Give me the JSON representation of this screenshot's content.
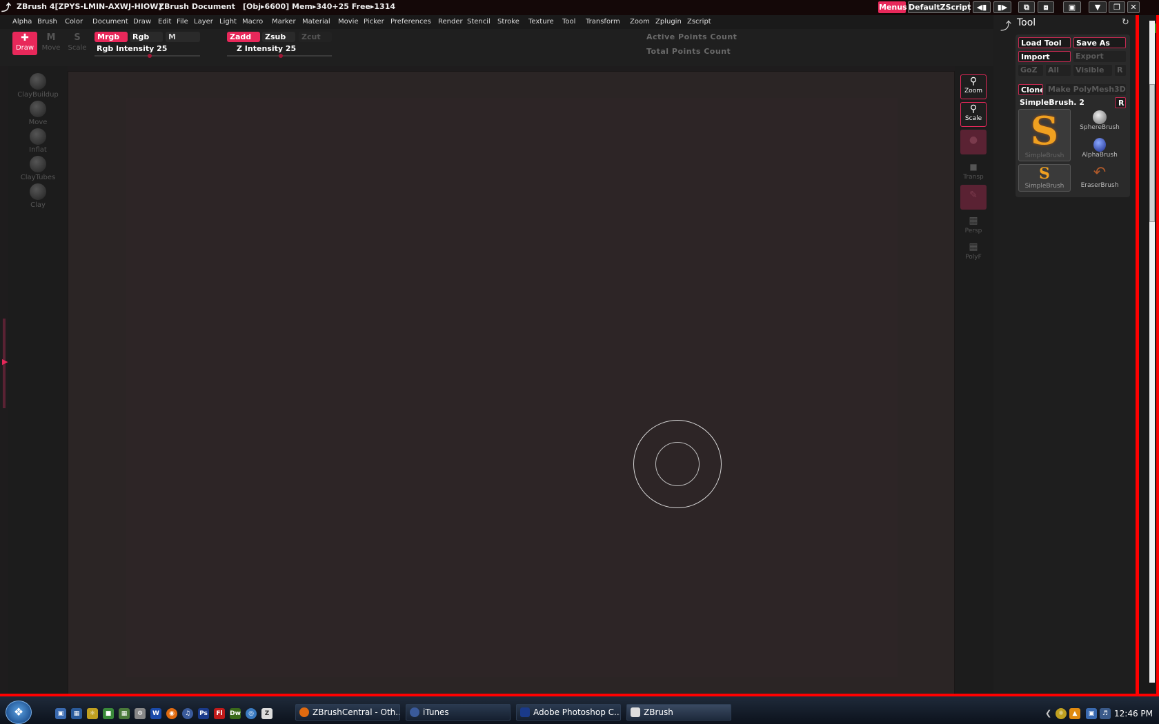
{
  "title_bar": {
    "app_title": "ZBrush 4[ZPYS-LMIN-AXWJ-HIOW]",
    "document": "ZBrush Document",
    "stats": "[Obj▸6600] Mem▸340+25 Free▸1314",
    "menus_button": "Menus",
    "zscript_button": "DefaultZScript"
  },
  "menu_bar": [
    "Alpha",
    "Brush",
    "Color",
    "Document",
    "Draw",
    "Edit",
    "File",
    "Layer",
    "Light",
    "Macro",
    "Marker",
    "Material",
    "Movie",
    "Picker",
    "Preferences",
    "Render",
    "Stencil",
    "Stroke",
    "Texture",
    "Tool",
    "Transform",
    "Zoom",
    "Zplugin",
    "Zscript"
  ],
  "shelf": {
    "draw_label": "Draw",
    "move_label": "Move",
    "scale_label": "Scale",
    "mrgb": "Mrgb",
    "rgb": "Rgb",
    "m": "M",
    "rgb_intensity_label": "Rgb Intensity",
    "rgb_intensity_value": "25",
    "zadd": "Zadd",
    "zsub": "Zsub",
    "zcut": "Zcut",
    "z_intensity_label": "Z Intensity",
    "z_intensity_value": "25",
    "active_points": "Active Points Count",
    "total_points": "Total Points Count"
  },
  "left_shelf": [
    "ClayBuildup",
    "Move",
    "Inflat",
    "ClayTubes",
    "Clay"
  ],
  "right_shelf": {
    "zoom": "Zoom",
    "scale": "Scale",
    "transp": "Transp",
    "persp": "Persp",
    "polyf": "PolyF"
  },
  "tool_panel": {
    "title": "Tool",
    "load_tool": "Load Tool",
    "save_as": "Save As",
    "import": "Import",
    "export": "Export",
    "goz": "GoZ",
    "all": "All",
    "visible": "Visible",
    "r": "R",
    "clone": "Clone",
    "make_polymesh": "Make PolyMesh3D",
    "current_tool": "SimpleBrush. 2",
    "r2": "R",
    "thumbs": {
      "main": "SimpleBrush",
      "sphere": "SphereBrush",
      "alpha": "AlphaBrush",
      "simple_small": "SimpleBrush",
      "eraser": "EraserBrush"
    }
  },
  "taskbar": {
    "tasks": [
      "ZBrushCentral - Oth...",
      "iTunes",
      "Adobe Photoshop C...",
      "ZBrush"
    ],
    "clock": "12:46 PM"
  },
  "colors": {
    "accent": "#e8285a",
    "frame_red": "#ff0000"
  }
}
